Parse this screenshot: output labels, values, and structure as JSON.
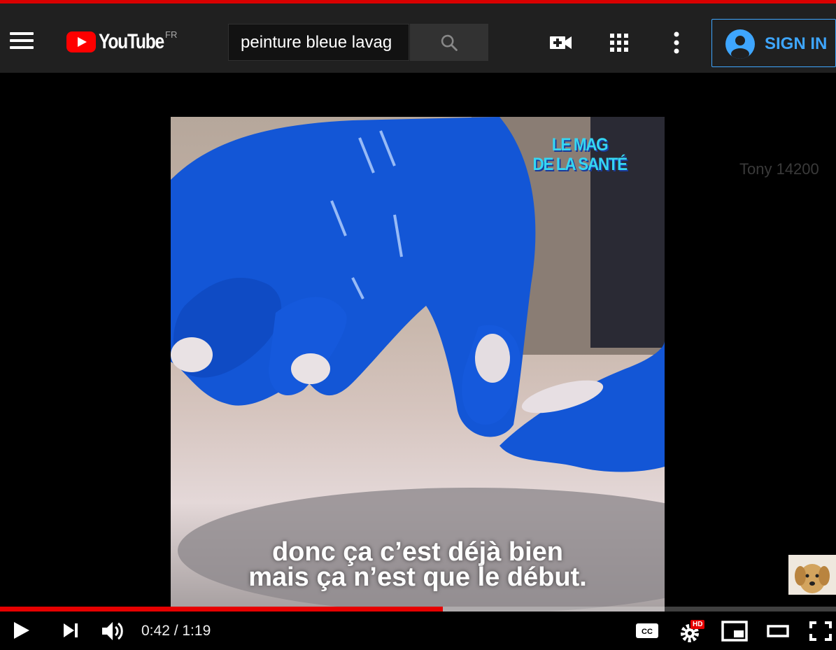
{
  "masthead": {
    "logo_text": "YouTube",
    "region": "FR",
    "search_value": "peinture bleue lavag",
    "sign_in_label": "SIGN IN"
  },
  "video": {
    "watermark_line1": "LE MAG",
    "watermark_line2": "DE LA SANTÉ",
    "subtitle_line1": "donc ça c’est déjà bien",
    "subtitle_line2": "mais ça n’est que le début.",
    "channel_label": "Tony 14200"
  },
  "player": {
    "current_time": "0:42",
    "duration": "1:19",
    "time_display": "0:42 / 1:19",
    "progress_fraction": 0.53,
    "quality_badge": "HD"
  },
  "icons": {
    "menu": "hamburger-menu-icon",
    "search": "search-icon",
    "create": "video-camera-plus-icon",
    "apps": "apps-grid-icon",
    "more": "more-vertical-icon",
    "account": "account-circle-icon",
    "play": "play-icon",
    "next": "skip-next-icon",
    "volume": "volume-icon",
    "captions": "closed-captions-icon",
    "settings": "settings-gear-icon",
    "miniplayer": "miniplayer-icon",
    "theater": "theater-mode-icon",
    "fullscreen": "fullscreen-icon"
  },
  "colors": {
    "masthead_bg": "#202020",
    "brand_red": "#ff0000",
    "sign_in_blue": "#3ea6ff",
    "progress_red": "#e60000",
    "watermark_cyan": "#35d6f3"
  }
}
